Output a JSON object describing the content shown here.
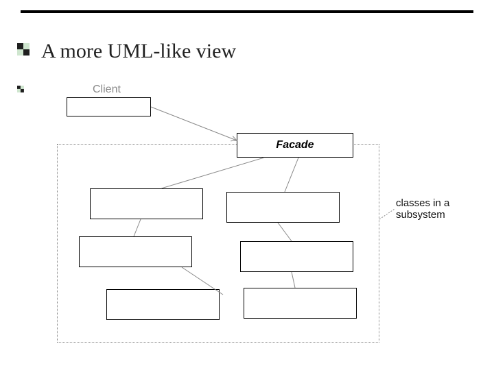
{
  "title": "A more UML-like view",
  "diagram": {
    "client_label": "Client",
    "facade_label": "Facade",
    "annotation_line1": "classes in a",
    "annotation_line2": "subsystem"
  },
  "colors": {
    "bullet_dark": "#1f1f1f",
    "bullet_light": "#cfe6cf"
  }
}
